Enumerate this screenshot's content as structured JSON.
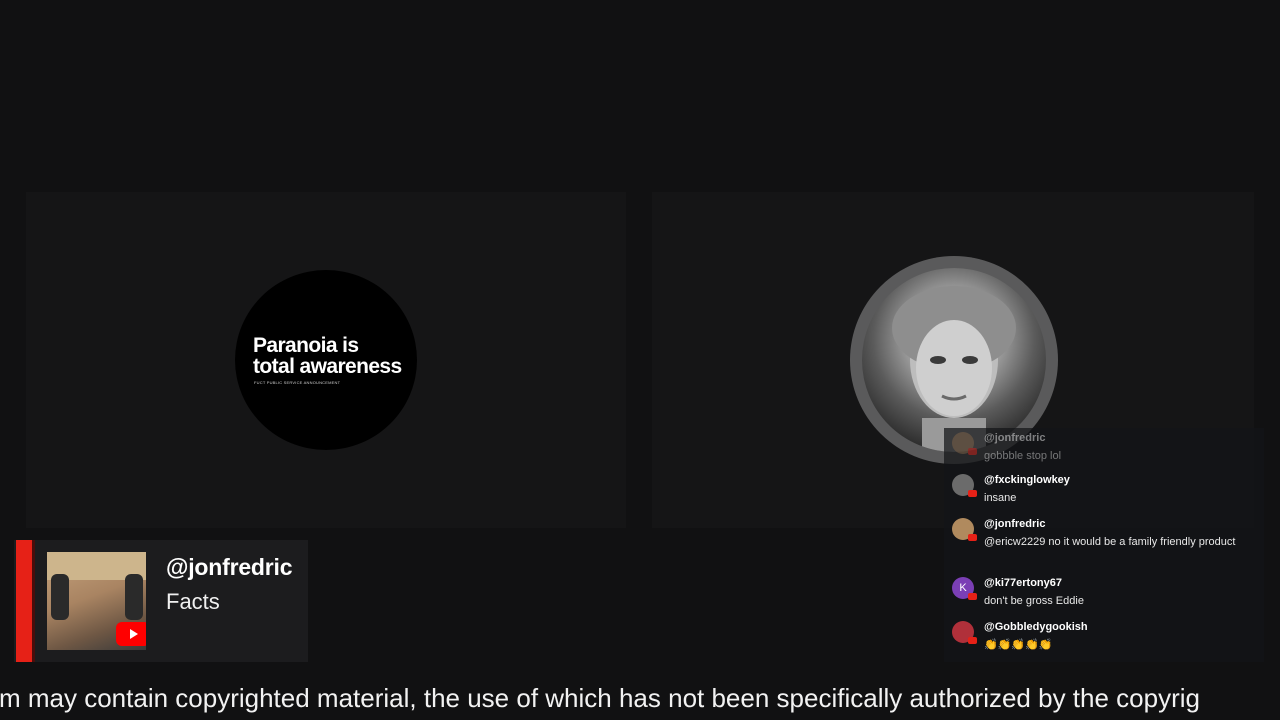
{
  "left_panel": {
    "avatar_text_line1": "Paranoia is",
    "avatar_text_line2": "total awareness",
    "avatar_tiny_text": "FUCT PUBLIC SERVICE ANNOUNCEMENT"
  },
  "chat": {
    "messages": [
      {
        "author": "@jonfredric",
        "text": "gobbble stop lol",
        "avatar_color": "#8a6a4a"
      },
      {
        "author": "@fxckinglowkey",
        "text": "insane",
        "avatar_color": "#6b6b6b"
      },
      {
        "author": "@jonfredric",
        "text": "@ericw2229 no it would be a family friendly product",
        "avatar_color": "#b08a5e"
      },
      {
        "author": "@ki77ertony67",
        "text": "don't be gross Eddie",
        "avatar_color": "#7b3fb5",
        "avatar_letter": "K"
      },
      {
        "author": "@Gobbledygookish",
        "text": "👏👏👏👏👏",
        "avatar_color": "#b0303a"
      }
    ]
  },
  "lower_third": {
    "handle": "@jonfredric",
    "subtitle": "Facts"
  },
  "ticker": {
    "text": "m may contain copyrighted material, the use of which has not been specifically authorized by the copyrig"
  },
  "colors": {
    "background": "#111112",
    "accent_red": "#e62117"
  }
}
